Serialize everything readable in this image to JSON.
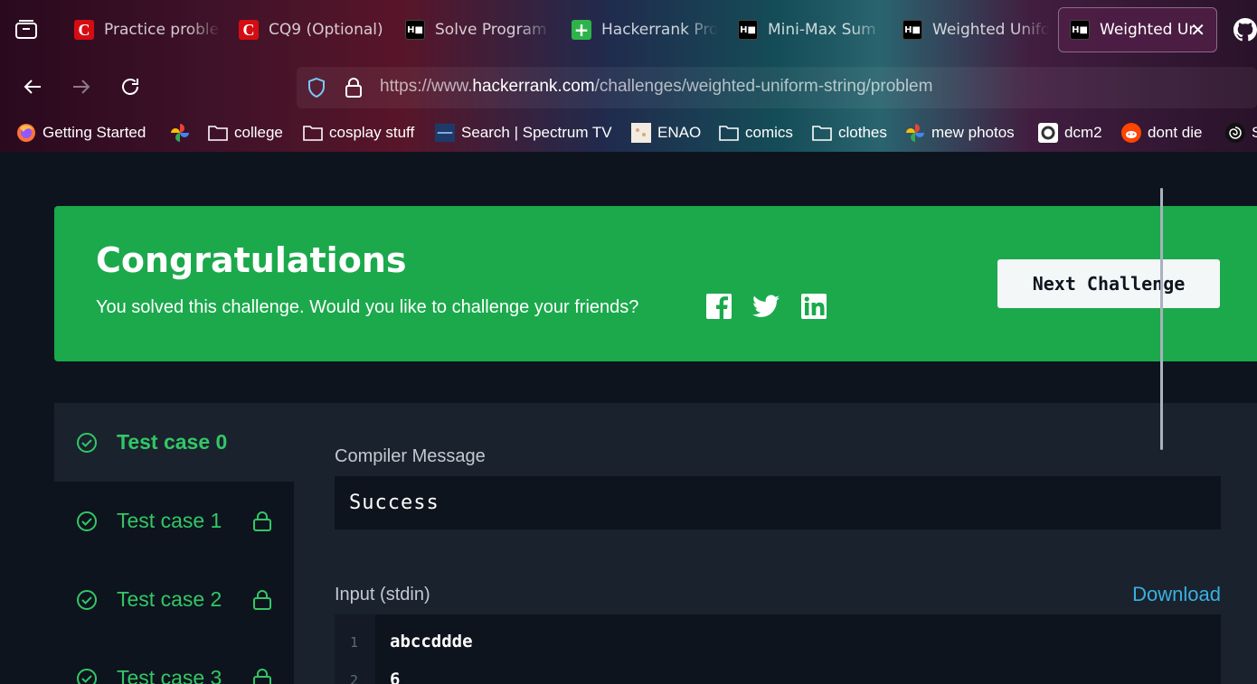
{
  "browser": {
    "tabs": [
      {
        "label": "Practice proble",
        "favicon": "C"
      },
      {
        "label": "CQ9 (Optional)",
        "favicon": "C"
      },
      {
        "label": "Solve Program",
        "favicon": "H"
      },
      {
        "label": "Hackerrank Pro",
        "favicon": "+"
      },
      {
        "label": "Mini-Max Sum",
        "favicon": "H"
      },
      {
        "label": "Weighted Unifo",
        "favicon": "H"
      },
      {
        "label": "Weighted Ur",
        "favicon": "H",
        "active": true
      }
    ],
    "url_prefix": "https://www.",
    "url_domain": "hackerrank.com",
    "url_path": "/challenges/weighted-uniform-string/problem",
    "bookmarks": [
      {
        "label": "Getting Started",
        "icon": "firefox-icon"
      },
      {
        "label": "",
        "icon": "pinwheel-icon"
      },
      {
        "label": "college",
        "icon": "folder-icon"
      },
      {
        "label": "cosplay stuff",
        "icon": "folder-icon"
      },
      {
        "label": "Search | Spectrum TV",
        "icon": "spectrum-icon"
      },
      {
        "label": "ENAO",
        "icon": "enao-icon"
      },
      {
        "label": "comics",
        "icon": "folder-icon"
      },
      {
        "label": "clothes",
        "icon": "folder-icon"
      },
      {
        "label": "mew photos",
        "icon": "google-photos-icon"
      },
      {
        "label": "dcm2",
        "icon": "dcm2-icon"
      },
      {
        "label": "dont die",
        "icon": "reddit-icon"
      },
      {
        "label": "S",
        "icon": "spiral-icon"
      }
    ]
  },
  "banner": {
    "title": "Congratulations",
    "subtitle": "You solved this challenge. Would you like to challenge your friends?",
    "next_button": "Next Challenge",
    "color": "#1ba94c"
  },
  "test_cases": [
    {
      "label": "Test case 0",
      "active": true,
      "locked": false
    },
    {
      "label": "Test case 1",
      "active": false,
      "locked": true
    },
    {
      "label": "Test case 2",
      "active": false,
      "locked": true
    },
    {
      "label": "Test case 3",
      "active": false,
      "locked": true
    }
  ],
  "result": {
    "compiler_label": "Compiler Message",
    "compiler_message": "Success",
    "input_label": "Input (stdin)",
    "download_label": "Download",
    "input_lines": [
      {
        "num": "1",
        "text": "abccddde"
      },
      {
        "num": "2",
        "text": "6"
      }
    ]
  }
}
